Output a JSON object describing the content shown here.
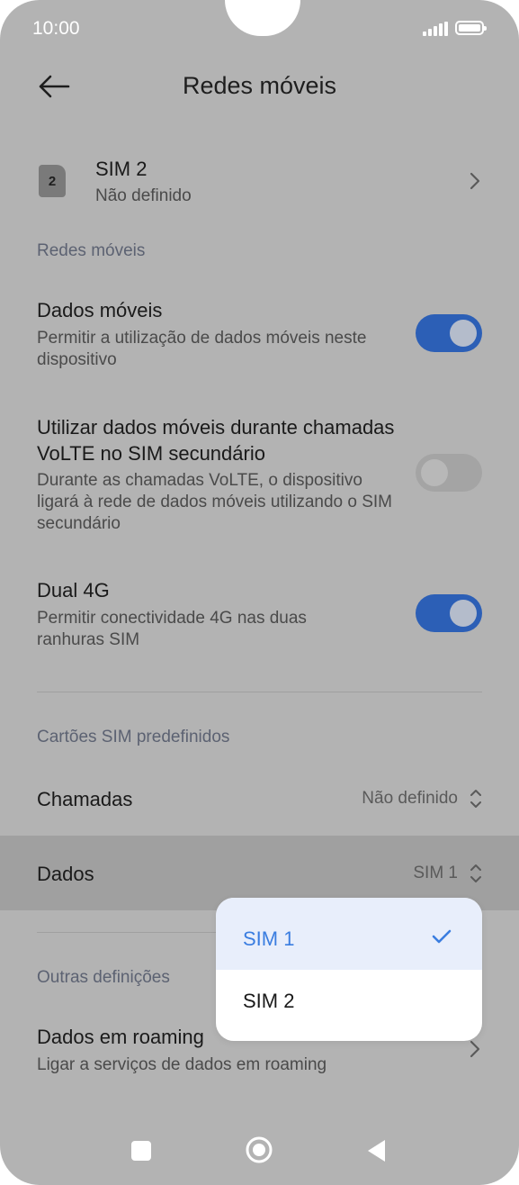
{
  "status_bar": {
    "time": "10:00"
  },
  "header": {
    "title": "Redes móveis",
    "back_icon": "arrow-left-icon"
  },
  "sim2": {
    "badge": "2",
    "title": "SIM 2",
    "subtitle": "Não definido"
  },
  "section_mobile": "Redes móveis",
  "mobile_data": {
    "title": "Dados móveis",
    "subtitle": "Permitir a utilização de dados móveis neste dispositivo",
    "enabled": true
  },
  "volte_data": {
    "title": "Utilizar dados móveis durante chamadas VoLTE no SIM secundário",
    "subtitle": "Durante as chamadas VoLTE, o dispositivo ligará à rede de dados móveis utilizando o SIM secundário",
    "enabled": false
  },
  "dual4g": {
    "title": "Dual 4G",
    "subtitle": "Permitir conectividade 4G nas duas ranhuras SIM",
    "enabled": true
  },
  "section_default_sim": "Cartões SIM predefinidos",
  "calls": {
    "label": "Chamadas",
    "value": "Não definido"
  },
  "data": {
    "label": "Dados",
    "value": "SIM 1"
  },
  "section_other": "Outras definições",
  "roaming": {
    "title": "Dados em roaming",
    "subtitle": "Ligar a serviços de dados em roaming"
  },
  "dropdown": {
    "options": [
      "SIM 1",
      "SIM 2"
    ],
    "selected": "SIM 1"
  },
  "colors": {
    "accent": "#2c5fb6",
    "selected_text": "#3a7de0",
    "background": "#b3b3b3"
  }
}
